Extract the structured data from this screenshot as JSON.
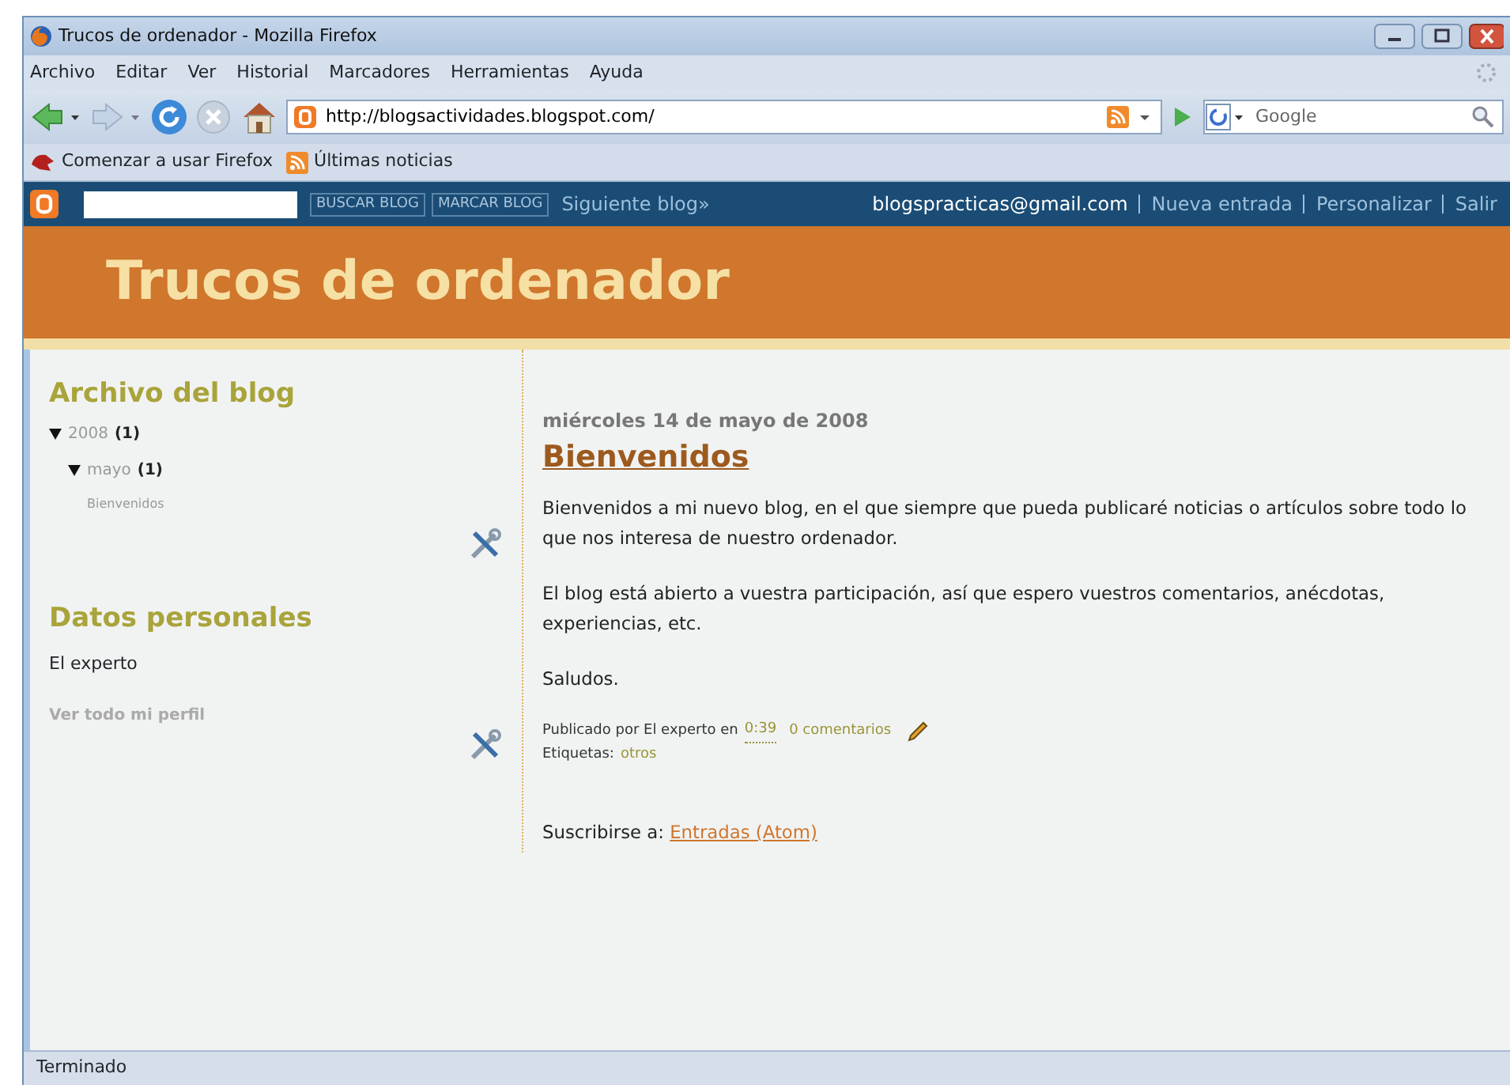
{
  "window": {
    "title": "Trucos de ordenador - Mozilla Firefox"
  },
  "menu": [
    "Archivo",
    "Editar",
    "Ver",
    "Historial",
    "Marcadores",
    "Herramientas",
    "Ayuda"
  ],
  "address_bar": {
    "value": "http://blogsactividades.blogspot.com/"
  },
  "search_box": {
    "placeholder": "Google"
  },
  "bookmarks": [
    {
      "label": "Comenzar a usar Firefox",
      "kind": "page"
    },
    {
      "label": "Últimas noticias",
      "kind": "feed"
    }
  ],
  "blogger_bar": {
    "search_buttons": [
      "BUSCAR BLOG",
      "MARCAR BLOG"
    ],
    "next_link": "Siguiente blog»",
    "user": "blogspracticas@gmail.com",
    "links": [
      "Nueva entrada",
      "Personalizar",
      "Salir"
    ]
  },
  "blog_title": "Trucos de ordenador",
  "sidebar": {
    "archive": {
      "title": "Archivo del blog",
      "tree": [
        {
          "label": "2008",
          "count": "(1)",
          "expanded": true,
          "children": [
            {
              "label": "mayo",
              "count": "(1)",
              "expanded": true,
              "children": [
                {
                  "label": "Bienvenidos"
                }
              ]
            }
          ]
        }
      ]
    },
    "profile": {
      "title": "Datos personales",
      "name": "El experto",
      "link": "Ver todo mi perfil"
    }
  },
  "post": {
    "date": "miércoles 14 de mayo de 2008",
    "title": "Bienvenidos",
    "paragraphs": [
      "Bienvenidos a mi nuevo blog, en el que siempre que pueda publicaré noticias o artículos sobre todo lo que nos interesa de nuestro ordenador.",
      "El blog está abierto a vuestra participación, así que espero vuestros comentarios, anécdotas, experiencias, etc.",
      "Saludos."
    ],
    "byline": "Publicado por El experto en",
    "time": "0:39",
    "comments": "0 comentarios",
    "labels_caption": "Etiquetas:",
    "labels": [
      "otros"
    ]
  },
  "subscribe": {
    "caption": "Suscribirse a:",
    "link": "Entradas (Atom)"
  },
  "status_bar": "Terminado"
}
